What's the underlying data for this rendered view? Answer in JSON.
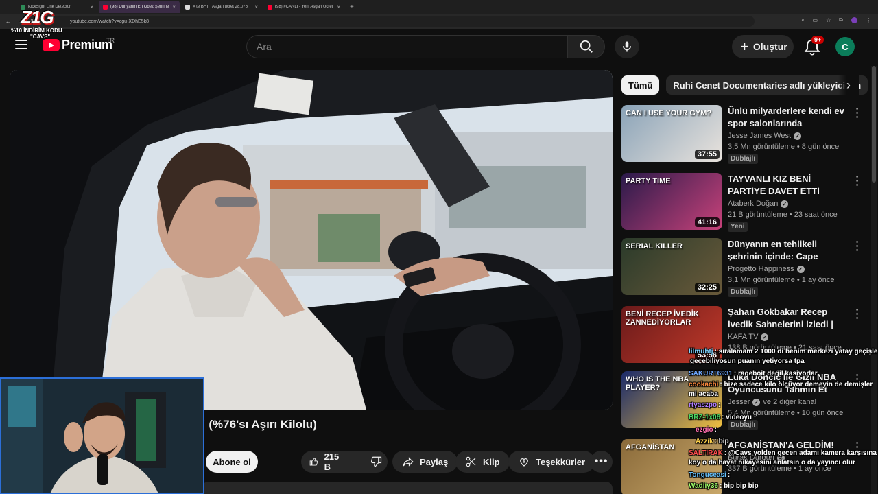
{
  "browser": {
    "tabs": [
      {
        "title": "KickSight Link Detector",
        "active": false,
        "favicon_color": "#2e8b57"
      },
      {
        "title": "(98) Dünyanın En Obez Şehrine",
        "active": true,
        "favicon_color": "#ff0033"
      },
      {
        "title": "X'te BFT: \"Asgari ücret 28.075 T",
        "active": false,
        "favicon_color": "#dddddd"
      },
      {
        "title": "(98) #CANLI - Yeni Asgari Ücret",
        "active": false,
        "favicon_color": "#ff0033"
      }
    ],
    "close_glyph": "×",
    "new_tab_glyph": "+",
    "url": "youtube.com/watch?v=cgu-XDhE5k8"
  },
  "overlay_logo": {
    "text": "Z1G",
    "promo_line1": "%10 İNDİRİM KODU",
    "promo_line2": "\"CAVS\""
  },
  "masthead": {
    "brand": "Premium",
    "country": "TR",
    "search_placeholder": "Ara",
    "create_label": "Oluştur",
    "notification_count": "9+",
    "avatar_letter": "C"
  },
  "video": {
    "title_visible": "! (%76'sı Aşırı Kilolu)",
    "subscribe_label": "Abone ol",
    "like_count": "215 B",
    "share_label": "Paylaş",
    "clip_label": "Klip",
    "thanks_label": "Teşekkürler"
  },
  "chips": [
    {
      "label": "Tümü",
      "active": true
    },
    {
      "label": "Ruhi Cenet Documentaries adlı yükleyiciden",
      "active": false
    }
  ],
  "recommendations": [
    {
      "title": "Ünlü milyarderlere kendi ev spor salonlarında antrenman ...",
      "channel": "Jesse James West",
      "verified": true,
      "meta": "3,5 Mn görüntüleme • 8 gün önce",
      "badge": "Dublajlı",
      "duration": "37:55",
      "thumb_colors": [
        "#8aa3b8",
        "#e9e3dd"
      ],
      "thumb_text": "CAN I USE YOUR GYM?"
    },
    {
      "title": "TAYVANLI KIZ BENİ PARTİYE DAVET ETTİ İZLİYORUZ! ...",
      "channel": "Ataberk Doğan",
      "verified": true,
      "meta": "21 B görüntüleme • 23 saat önce",
      "badge": "Yeni",
      "duration": "41:16",
      "thumb_colors": [
        "#2a1a4a",
        "#c8427a"
      ],
      "thumb_text": "PARTY TIME"
    },
    {
      "title": "Dünyanın en tehlikeli şehrinin içinde: Cape Town'da yaşamak...",
      "channel": "Progetto Happiness",
      "verified": true,
      "meta": "3,1 Mn görüntüleme • 1 ay önce",
      "badge": "Dublajlı",
      "duration": "32:25",
      "thumb_colors": [
        "#2a3a2a",
        "#6a5a3a"
      ],
      "thumb_text": "SERIAL KILLER"
    },
    {
      "title": "Şahan Gökbakar Recep İvedik Sahnelerini İzledi | Fenomen ...",
      "channel": "KAFA TV",
      "verified": true,
      "meta": "138 B görüntüleme • 21 saat önce",
      "badge": "",
      "duration": "53:58",
      "thumb_colors": [
        "#6a1a1a",
        "#c23a2a"
      ],
      "thumb_text": "BENİ RECEP İVEDİK ZANNEDİYORLAR"
    },
    {
      "title": "Luka Doncic ile Gizli NBA Oyuncusunu Tahmin Et",
      "channel": "Jesser",
      "channel_extra": "ve 2 diğer kanal",
      "verified": true,
      "meta": "5,4 Mn görüntüleme • 10 gün önce",
      "badge": "Dublajlı",
      "duration": "",
      "thumb_colors": [
        "#1a2a6a",
        "#f0c040"
      ],
      "thumb_text": "WHO IS THE NBA PLAYER?"
    },
    {
      "title": "AFGANİSTAN'A GELDİM!",
      "channel": "Burak Durgun",
      "verified": true,
      "meta": "337 B görüntüleme • 1 ay önce",
      "badge": "",
      "duration": "",
      "thumb_colors": [
        "#8a6a3a",
        "#c9a86a"
      ],
      "thumb_text": "AFGANİSTAN"
    }
  ],
  "chat": [
    {
      "user": "lilmuhtj",
      "text": ": sıralamam 2 1000 di benim merkezi yatay geçişle",
      "color": "#7fd3ff"
    },
    {
      "user": "",
      "text": "geçebiliyosun puanın yetiyorsa tpa",
      "color": "#ffffff"
    },
    {
      "user": "SAKURT6931",
      "text": ": rageboit değil kasiyorlar",
      "color": "#6fa8ff"
    },
    {
      "user": "cookachi",
      "text": ": bize sadece kilo ölçüyor demeyin de demişler",
      "color": "#ff8a3d"
    },
    {
      "user": "",
      "text": "mi acaba",
      "color": "#ffffff"
    },
    {
      "user": "rtyaszpo",
      "text": ":",
      "color": "#b07cff"
    },
    {
      "user": "BRZ-1x06",
      "text": ": videoyu",
      "color": "#4cd964"
    },
    {
      "user": "ezgio",
      "text": ":",
      "color": "#ff6fb0"
    },
    {
      "user": "Azzik",
      "text": ": bip",
      "color": "#ffd24c"
    },
    {
      "user": "SALTIRAK",
      "text": ": @Cavs yolden gecen adamı kamera karşısına",
      "color": "#ff4d4d"
    },
    {
      "user": "",
      "text": "koy o da hayat hikayesini anlatsın o da yayıncı olur",
      "color": "#ffffff"
    },
    {
      "user": "Tonguceasi",
      "text": ":",
      "color": "#66c2ff"
    },
    {
      "user": "Wadiiy36",
      "text": ": bip bip bip",
      "color": "#a0ff6a"
    }
  ]
}
